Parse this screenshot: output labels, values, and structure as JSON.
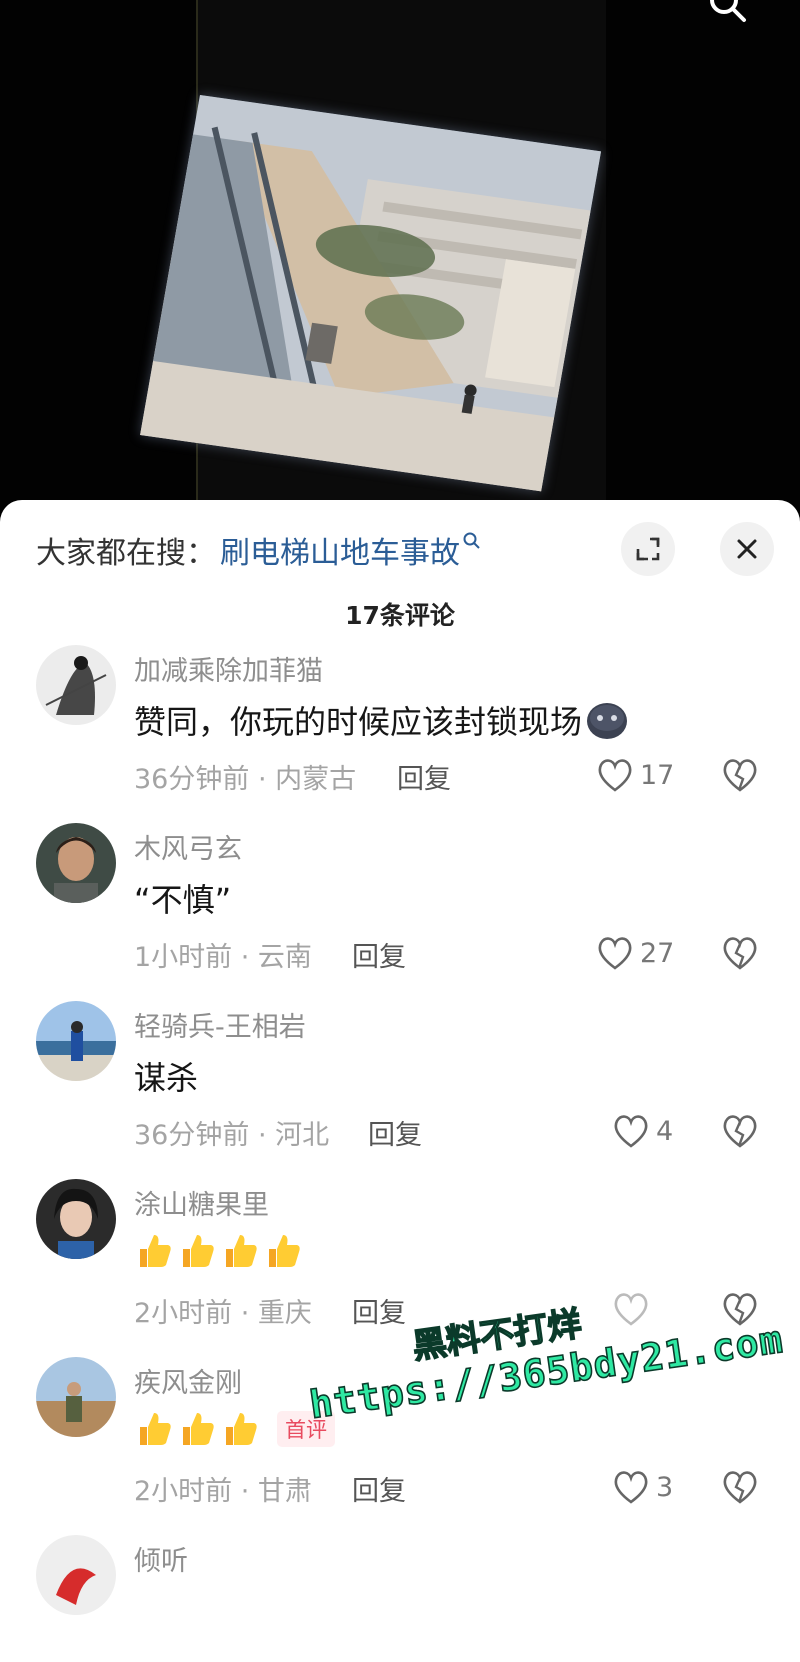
{
  "header": {
    "hot_search_prefix": "大家都在搜：",
    "hot_search_term": "刷电梯山地车事故",
    "comment_count_title": "17条评论"
  },
  "comments": [
    {
      "name": "加减乘除加菲猫",
      "text": "赞同，你玩的时候应该封锁现场",
      "emoji": "dark-face-emoji",
      "time_location": "36分钟前 · 内蒙古",
      "reply": "回复",
      "likes": "17"
    },
    {
      "name": "木风弓玄",
      "text": "“不慎”",
      "time_location": "1小时前 · 云南",
      "reply": "回复",
      "likes": "27"
    },
    {
      "name": "轻骑兵-王相岩",
      "text": "谋杀",
      "time_location": "36分钟前 · 河北",
      "reply": "回复",
      "likes": "4"
    },
    {
      "name": "涂山糖果里",
      "emoji_count": 4,
      "time_location": "2小时前 · 重庆",
      "reply": "回复"
    },
    {
      "name": "疾风金刚",
      "emoji_count": 3,
      "badge": "首评",
      "time_location": "2小时前 · 甘肃",
      "reply": "回复",
      "likes": "3"
    },
    {
      "name": "倾听"
    }
  ],
  "watermark": {
    "line1": "黑料不打烊",
    "line2": "https://365bdy21.com"
  },
  "colors": {
    "hot_term": "#2b5d96",
    "watermark": "#2fe9a3",
    "badge": "#e84b5f"
  },
  "icons": [
    "search-icon",
    "expand-icon",
    "close-icon",
    "heart-icon",
    "broken-heart-icon",
    "thumbs-up-emoji"
  ]
}
